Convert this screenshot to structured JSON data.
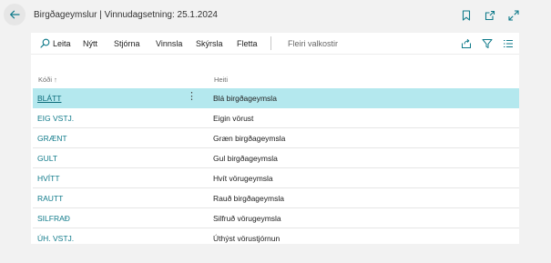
{
  "header": {
    "title": "Birgðageymslur | Vinnudagsetning: 25.1.2024",
    "icons": [
      "back-arrow-icon",
      "bookmark-icon",
      "open-new-window-icon",
      "expand-icon"
    ]
  },
  "toolbar": {
    "search_label": "Leita",
    "new_label": "Nýtt",
    "manage_label": "Stjórna",
    "process_label": "Vinnsla",
    "report_label": "Skýrsla",
    "navigate_label": "Fletta",
    "more_options_label": "Fleiri valkostir",
    "right_icons": [
      "share-icon",
      "filter-icon",
      "list-view-icon"
    ]
  },
  "table": {
    "columns": {
      "code": "Kóði ↑",
      "name": "Heiti"
    },
    "rows": [
      {
        "code": "BLÁTT",
        "name": "Blá birgðageymsla",
        "selected": true
      },
      {
        "code": "EIG VSTJ.",
        "name": "Eigin vörust"
      },
      {
        "code": "GRÆNT",
        "name": "Græn birgðageymsla"
      },
      {
        "code": "GULT",
        "name": "Gul birgðageymsla"
      },
      {
        "code": "HVÍTT",
        "name": "Hvít vörugeymsla"
      },
      {
        "code": "RAUTT",
        "name": "Rauð birgðageymsla"
      },
      {
        "code": "SILFRAÐ",
        "name": "Silfruð vörugeymsla"
      },
      {
        "code": "ÚH. VSTJ.",
        "name": "Úthýst vörustjórnun"
      }
    ],
    "row_menu_glyph": "⋮"
  },
  "colors": {
    "accent": "#0f7a8a",
    "selected_row": "#b4e8ee",
    "page_background": "#f2f2f2"
  }
}
